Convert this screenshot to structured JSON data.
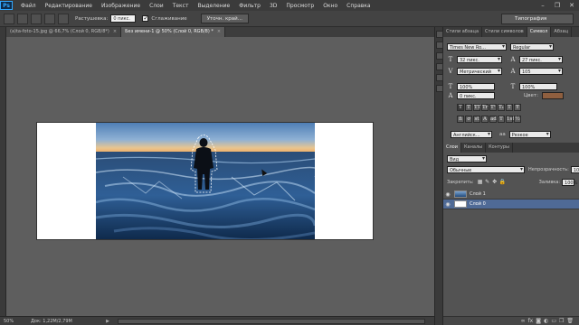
{
  "menu": [
    "Файл",
    "Редактирование",
    "Изображение",
    "Слои",
    "Текст",
    "Выделение",
    "Фильтр",
    "3D",
    "Просмотр",
    "Окно",
    "Справка"
  ],
  "options": {
    "feather_label": "Растушевка:",
    "feather_value": "0 пикс.",
    "antialias_label": "Сглаживание",
    "refine_button": "Уточн. край...",
    "workspace": "Типография"
  },
  "tabs": [
    "(a)ta-foto-15.jpg @ 66,7% (Слой 0, RGB/8*)",
    "Без имени-1 @ 50% (Слой 0, RGB/8) *"
  ],
  "status": {
    "zoom": "50%",
    "doc_info": "Док: 1,22M/2,79M"
  },
  "character_panel": {
    "tabs": [
      "Стили абзаца",
      "Стили символов",
      "Символ",
      "Абзац"
    ],
    "font_family": "Times New Ro...",
    "font_style": "Regular",
    "font_size": "32 пикс.",
    "leading": "27 пикс.",
    "kerning": "Метрический",
    "tracking": "105",
    "vertical_scale": "100%",
    "horizontal_scale": "100%",
    "baseline_shift": "0 пикс.",
    "color_label": "Цвет:",
    "color_value": "#8f5f3f",
    "style_buttons": [
      "T",
      "T",
      "TT",
      "Tr",
      "T¹",
      "T₁",
      "T",
      "Ŧ"
    ],
    "extra_buttons": [
      "fi",
      "ơ",
      "st",
      "A",
      "ad",
      "T",
      "1st",
      "½"
    ],
    "language": "Английск...",
    "antialias_method": "Резкое",
    "aa_icon": "aa"
  },
  "layers_panel": {
    "tabs": [
      "Слои",
      "Каналы",
      "Контуры"
    ],
    "filter": "Вид",
    "blend_mode": "Обычные",
    "opacity_label": "Непрозрачность:",
    "opacity_value": "100%",
    "lock_label": "Закрепить:",
    "fill_label": "Заливка:",
    "fill_value": "100%",
    "layers": [
      {
        "name": "Слой 1",
        "visible": true,
        "selected": false
      },
      {
        "name": "Слой 0",
        "visible": true,
        "selected": true
      }
    ]
  }
}
